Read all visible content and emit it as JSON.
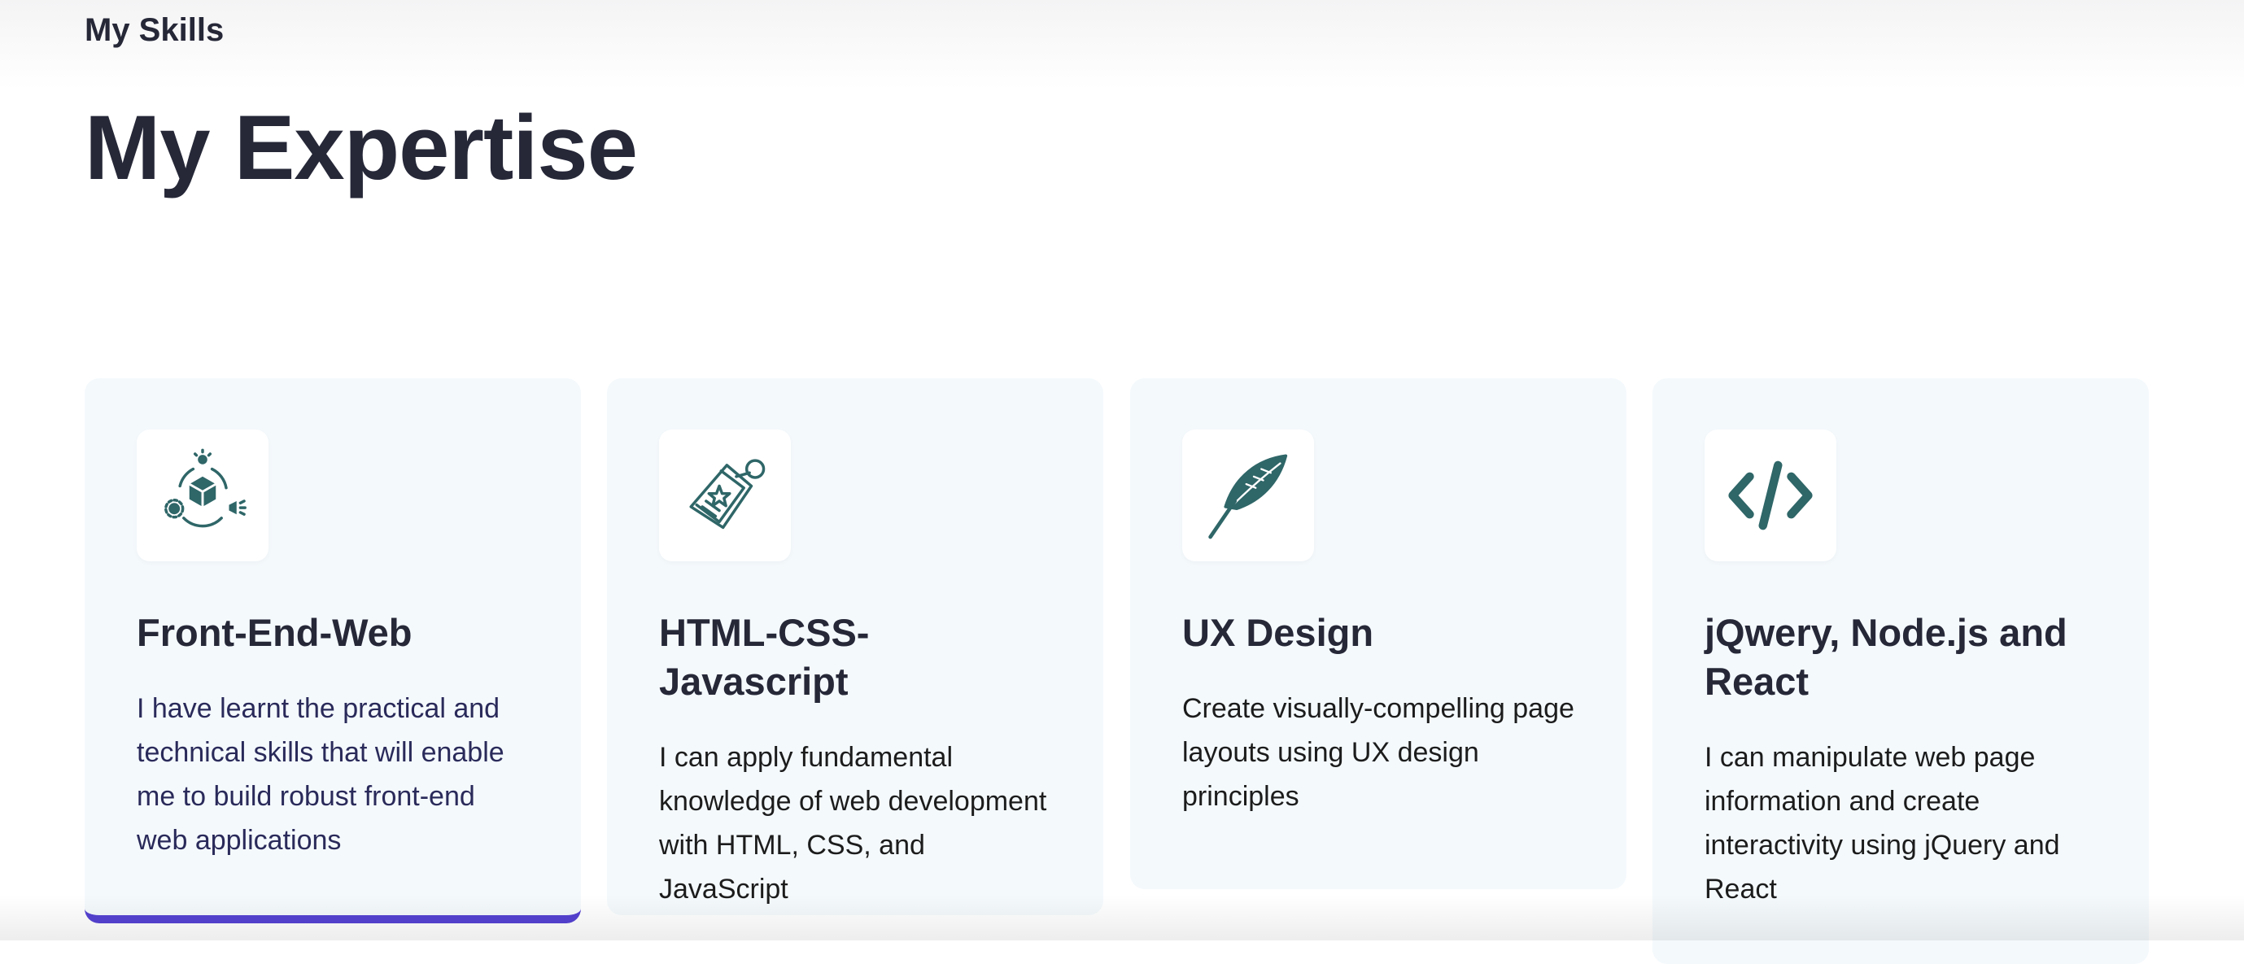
{
  "section_label": "My Skills",
  "page_title": "My Expertise",
  "colors": {
    "accent": "#5542d2",
    "icon": "#2f6668",
    "card_bg": "#f4f9fc"
  },
  "cards": [
    {
      "icon": "product-development-icon",
      "title": "Front-End-Web",
      "description": "I have learnt the practical and technical skills that will enable me to build robust front-end web applications"
    },
    {
      "icon": "price-tag-icon",
      "title": "HTML-CSS-Javascript",
      "description": "I can apply fundamental knowledge of web development with HTML, CSS, and JavaScript"
    },
    {
      "icon": "feather-icon",
      "title": "UX Design",
      "description": "Create visually-compelling page layouts using UX design principles"
    },
    {
      "icon": "code-icon",
      "title": "jQwery, Node.js and React",
      "description": "I can manipulate web page information and create interactivity using jQuery and React"
    }
  ]
}
